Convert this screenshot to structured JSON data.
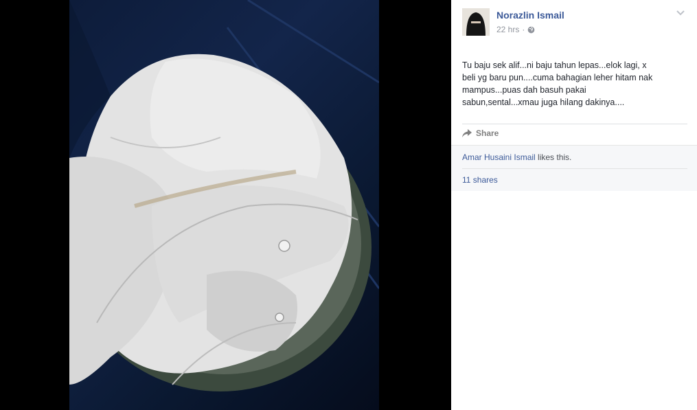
{
  "post": {
    "author": "Norazlin Ismail",
    "time": "22 hrs",
    "separator": "·",
    "privacy_icon": "globe-icon",
    "text_lines": [
      "Tu baju sek alif...ni baju tahun lepas...elok lagi, x",
      "beli yg baru pun....cuma bahagian leher hitam nak",
      "mampus...puas dah basuh pakai",
      "sabun,sental...xmau juga hilang dakinya...."
    ],
    "share_label": "Share",
    "liker": "Amar Husaini Ismail",
    "likes_suffix": " likes this.",
    "shares_count": "11 shares"
  },
  "colors": {
    "link": "#3b5998",
    "muted": "#90949c",
    "social_bg": "#f6f7f9",
    "stage_bg": "#000000"
  },
  "photo": {
    "subject": "white school shirt in a basin"
  }
}
